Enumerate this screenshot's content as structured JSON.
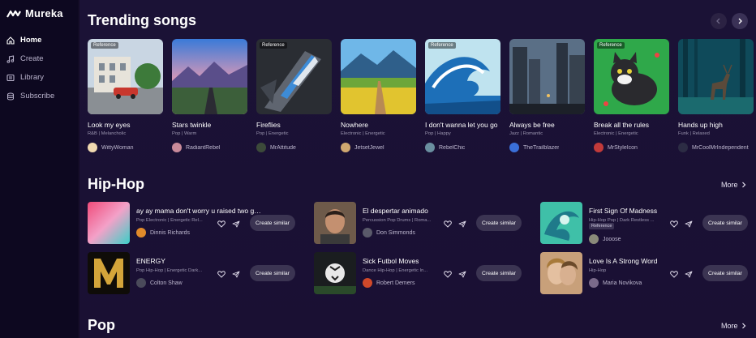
{
  "app": {
    "name": "Mureka"
  },
  "sidebar": {
    "items": [
      {
        "label": "Home",
        "icon": "home-icon",
        "active": true
      },
      {
        "label": "Create",
        "icon": "music-note-icon",
        "active": false
      },
      {
        "label": "Library",
        "icon": "library-icon",
        "active": false
      },
      {
        "label": "Subscribe",
        "icon": "subscribe-icon",
        "active": false
      }
    ]
  },
  "trending": {
    "title": "Trending songs",
    "ref_label": "Reference",
    "cards": [
      {
        "title": "Look my eyes",
        "tags": "R&B | Melancholic",
        "user": "WittyWoman",
        "reference": true
      },
      {
        "title": "Stars twinkle",
        "tags": "Pop | Warm",
        "user": "RadiantRebel",
        "reference": false
      },
      {
        "title": "Fireflies",
        "tags": "Pop | Energetic",
        "user": "MrAttitude",
        "reference": true
      },
      {
        "title": "Nowhere",
        "tags": "Electronic | Energetic",
        "user": "JetsetJewel",
        "reference": false
      },
      {
        "title": "I don't wanna let you go",
        "tags": "Pop | Happy",
        "user": "RebelChic",
        "reference": true
      },
      {
        "title": "Always be free",
        "tags": "Jazz | Romantic",
        "user": "TheTrailblazer",
        "reference": false
      },
      {
        "title": "Break all the rules",
        "tags": "Electronic | Energetic",
        "user": "MrStyleIcon",
        "reference": true
      },
      {
        "title": "Hands up high",
        "tags": "Funk | Relaxed",
        "user": "MrCoolMrIndependent",
        "reference": false
      }
    ]
  },
  "hiphop": {
    "title": "Hip-Hop",
    "more_label": "More",
    "create_label": "Create similar",
    "ref_label": "Reference",
    "items": [
      {
        "title": "ay ay mama don't worry u raised two gais",
        "tags": "Pop Electronic | Energetic Rel...",
        "user": "Dinnis Richards"
      },
      {
        "title": "El despertar animado",
        "tags": "Percussion Pop Drums | Roma...",
        "user": "Don Simmonds"
      },
      {
        "title": "First Sign Of Madness",
        "tags": "Hip-Hop Pop | Dark Restless ...",
        "user": "Jooose",
        "reference": true
      },
      {
        "title": "ENERGY",
        "tags": "Pop Hip-Hop | Energetic Dark...",
        "user": "Colton Shaw"
      },
      {
        "title": "Sick Futbol Moves",
        "tags": "Dance Hip-Hop | Energetic In...",
        "user": "Robert Demers"
      },
      {
        "title": "Love Is A Strong Word",
        "tags": "Hip-Hop",
        "user": "Maria Novikova"
      }
    ]
  },
  "pop": {
    "title": "Pop",
    "more_label": "More"
  }
}
